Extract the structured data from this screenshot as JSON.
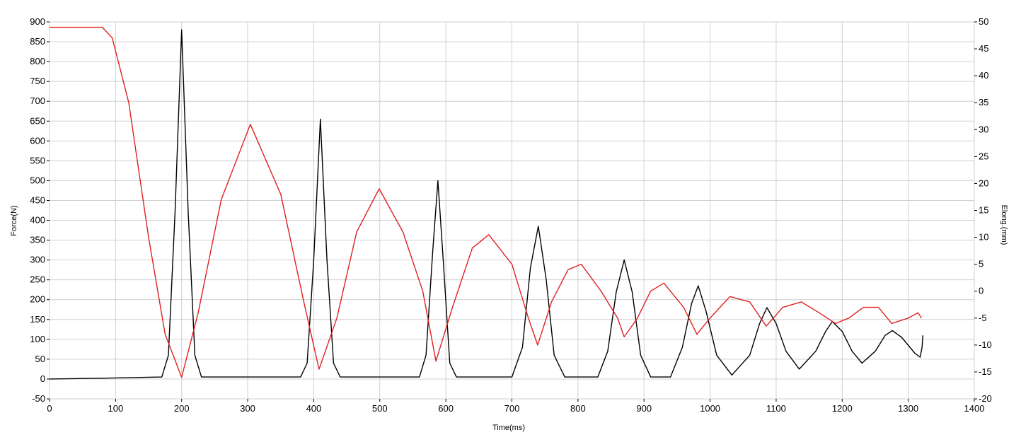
{
  "chart_data": {
    "type": "line",
    "title": "",
    "xlabel": "Time(ms)",
    "ylabel": "Force(N)",
    "y2label": "Elong.(mm)",
    "xlim": [
      0,
      1400
    ],
    "ylim": [
      -50,
      900
    ],
    "y2lim": [
      -20,
      50
    ],
    "grid": true,
    "x_ticks": [
      "0",
      "100",
      "200",
      "300",
      "400",
      "500",
      "600",
      "700",
      "800",
      "900",
      "1000",
      "1100",
      "1200",
      "1300",
      "1400"
    ],
    "y_ticks": [
      "-50",
      "0",
      "50",
      "100",
      "150",
      "200",
      "250",
      "300",
      "350",
      "400",
      "450",
      "500",
      "550",
      "600",
      "650",
      "700",
      "750",
      "800",
      "850",
      "900"
    ],
    "y2_ticks": [
      "-20",
      "-15",
      "-10",
      "-5",
      "0",
      "5",
      "10",
      "15",
      "20",
      "25",
      "30",
      "35",
      "40",
      "45",
      "50"
    ],
    "series": [
      {
        "axis": "left",
        "color": "#000000",
        "x": [
          0,
          80,
          170,
          180,
          190,
          200,
          210,
          220,
          230,
          380,
          390,
          400,
          410,
          420,
          430,
          440,
          560,
          570,
          580,
          588,
          596,
          606,
          616,
          700,
          716,
          728,
          740,
          752,
          764,
          780,
          830,
          845,
          858,
          870,
          882,
          895,
          910,
          940,
          958,
          972,
          982,
          994,
          1010,
          1033,
          1060,
          1075,
          1086,
          1100,
          1115,
          1135,
          1160,
          1175,
          1185,
          1200,
          1215,
          1230,
          1250,
          1265,
          1276,
          1290,
          1310,
          1318,
          1321,
          1322
        ],
        "values": [
          0,
          2,
          5,
          60,
          420,
          880,
          420,
          60,
          5,
          5,
          40,
          300,
          655,
          300,
          40,
          5,
          5,
          60,
          320,
          500,
          300,
          40,
          5,
          5,
          80,
          280,
          385,
          250,
          60,
          5,
          5,
          70,
          220,
          300,
          220,
          60,
          5,
          5,
          80,
          190,
          235,
          170,
          60,
          10,
          60,
          140,
          180,
          140,
          70,
          25,
          70,
          120,
          145,
          120,
          70,
          40,
          70,
          110,
          122,
          105,
          65,
          55,
          80,
          110
        ]
      },
      {
        "axis": "right",
        "color": "#e02020",
        "x": [
          0,
          80,
          95,
          120,
          150,
          175,
          200,
          225,
          260,
          304,
          350,
          385,
          408,
          435,
          465,
          499,
          535,
          565,
          585,
          610,
          640,
          665,
          700,
          725,
          739,
          760,
          785,
          805,
          835,
          860,
          870,
          890,
          910,
          930,
          960,
          980,
          1000,
          1030,
          1060,
          1085,
          1110,
          1138,
          1165,
          1190,
          1210,
          1232,
          1255,
          1275,
          1300,
          1315,
          1320
        ],
        "values": [
          49,
          49,
          47,
          35,
          10,
          -8,
          -16,
          -4,
          17,
          31,
          18,
          -2,
          -14.5,
          -5,
          11,
          19,
          11,
          0,
          -13,
          -3,
          8,
          10.5,
          5,
          -5,
          -10,
          -2,
          4,
          5,
          0,
          -5,
          -8.5,
          -5,
          0,
          1.5,
          -3,
          -8,
          -5,
          -1,
          -2,
          -6.5,
          -3,
          -2,
          -4,
          -6,
          -5,
          -3,
          -3,
          -6,
          -5,
          -4,
          -5
        ]
      }
    ]
  }
}
